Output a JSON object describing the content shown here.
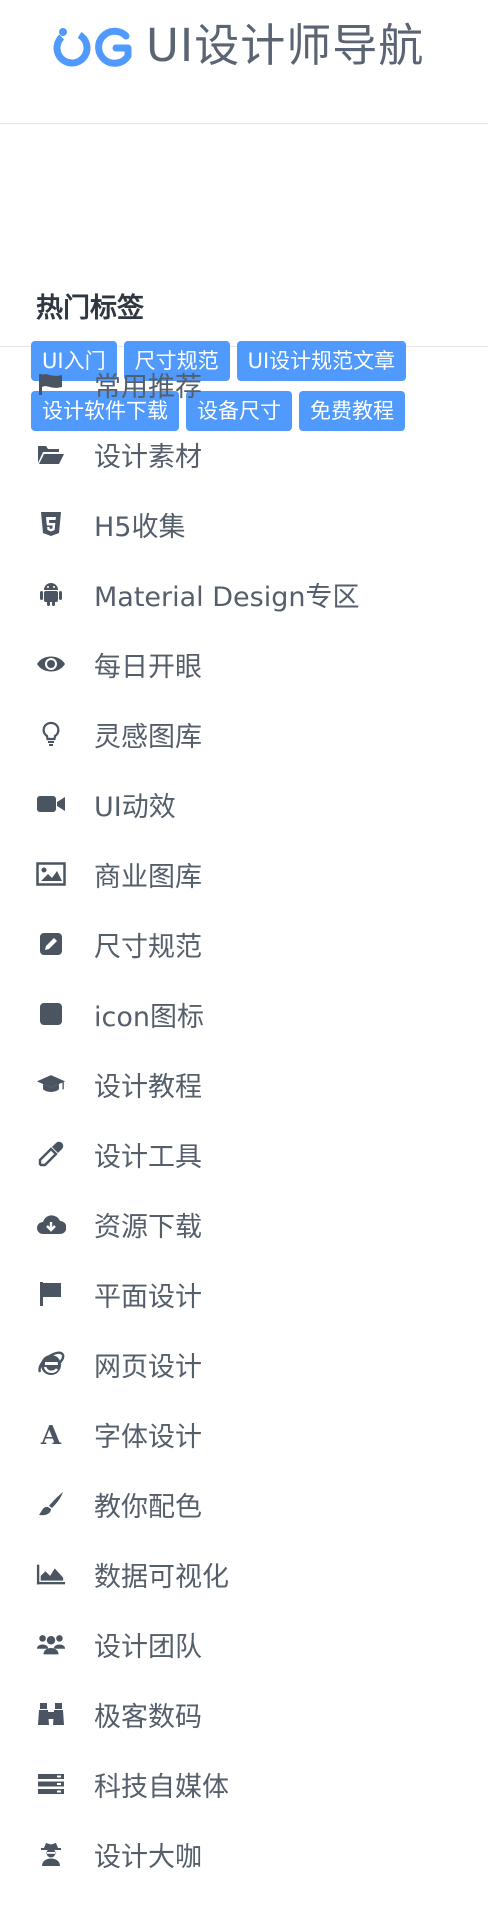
{
  "header": {
    "logo_text": "UI设计师导航",
    "logo_color": "#4f9afc"
  },
  "tags": {
    "heading": "热门标签",
    "items": [
      "UI入门",
      "尺寸规范",
      "UI设计规范文章",
      "设计软件下载",
      "设备尺寸",
      "免费教程"
    ],
    "color": "#4f9afc"
  },
  "menu": [
    {
      "label": "常用推荐",
      "icon": "flag-icon"
    },
    {
      "label": "设计素材",
      "icon": "folder-open-icon"
    },
    {
      "label": "H5收集",
      "icon": "html5-icon"
    },
    {
      "label": "Material Design专区",
      "icon": "android-icon"
    },
    {
      "label": "每日开眼",
      "icon": "eye-icon"
    },
    {
      "label": "灵感图库",
      "icon": "lightbulb-icon"
    },
    {
      "label": "UI动效",
      "icon": "video-camera-icon"
    },
    {
      "label": "商业图库",
      "icon": "image-icon"
    },
    {
      "label": "尺寸规范",
      "icon": "edit-icon"
    },
    {
      "label": "icon图标",
      "icon": "square-icon"
    },
    {
      "label": "设计教程",
      "icon": "graduation-cap-icon"
    },
    {
      "label": "设计工具",
      "icon": "eyedropper-icon"
    },
    {
      "label": "资源下载",
      "icon": "cloud-download-icon"
    },
    {
      "label": "平面设计",
      "icon": "flag-filled-icon"
    },
    {
      "label": "网页设计",
      "icon": "internet-explorer-icon"
    },
    {
      "label": "字体设计",
      "icon": "font-icon"
    },
    {
      "label": "教你配色",
      "icon": "paint-brush-icon"
    },
    {
      "label": "数据可视化",
      "icon": "area-chart-icon"
    },
    {
      "label": "设计团队",
      "icon": "users-icon"
    },
    {
      "label": "极客数码",
      "icon": "binoculars-icon"
    },
    {
      "label": "科技自媒体",
      "icon": "server-icon"
    },
    {
      "label": "设计大咖",
      "icon": "user-secret-icon"
    }
  ]
}
